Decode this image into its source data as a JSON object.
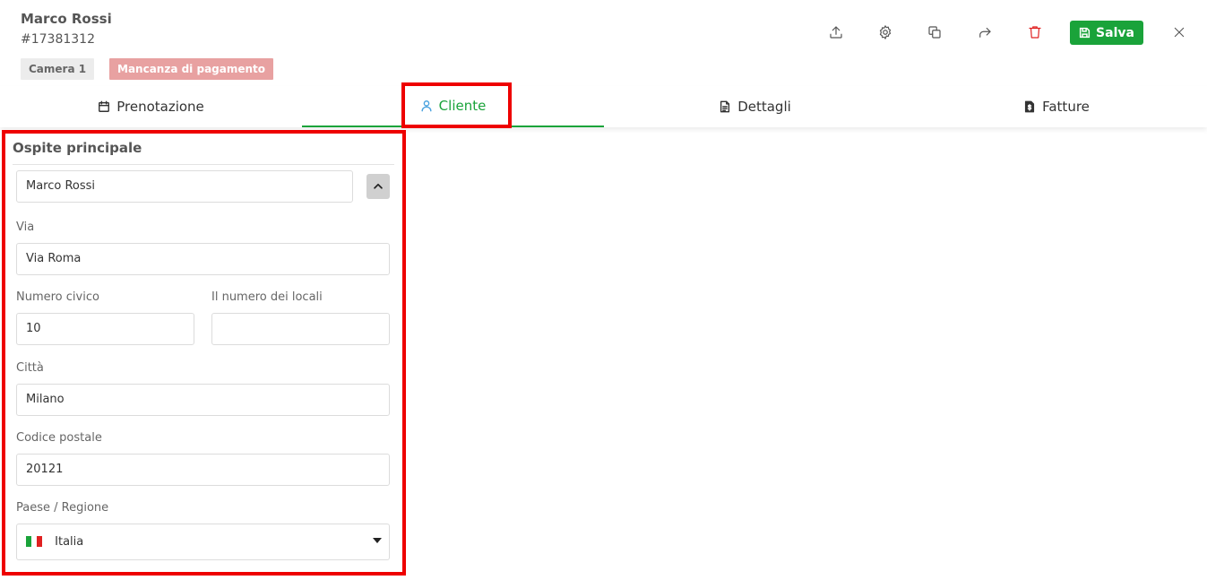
{
  "header": {
    "guest_name": "Marco Rossi",
    "booking_id": "#17381312",
    "room_badge": "Camera 1",
    "status_badge": "Mancanza di pagamento",
    "save_label": "Salva"
  },
  "tabs": [
    {
      "label": "Prenotazione",
      "icon": "calendar-icon"
    },
    {
      "label": "Cliente",
      "icon": "user-icon",
      "active": true
    },
    {
      "label": "Dettagli",
      "icon": "document-icon"
    },
    {
      "label": "Fatture",
      "icon": "invoice-icon"
    }
  ],
  "client": {
    "section_title": "Ospite principale",
    "guest_select": "Marco Rossi",
    "street_label": "Via",
    "street_value": "Via Roma",
    "house_number_label": "Numero civico",
    "house_number_value": "10",
    "rooms_label": "Il numero dei locali",
    "rooms_value": "",
    "city_label": "Città",
    "city_value": "Milano",
    "postal_label": "Codice postale",
    "postal_value": "20121",
    "country_label": "Paese / Regione",
    "country_value": "Italia"
  },
  "colors": {
    "accent": "#1aa33a",
    "danger": "#e02020",
    "status_badge_bg": "#e8a1a1",
    "highlight": "#ee0000"
  }
}
